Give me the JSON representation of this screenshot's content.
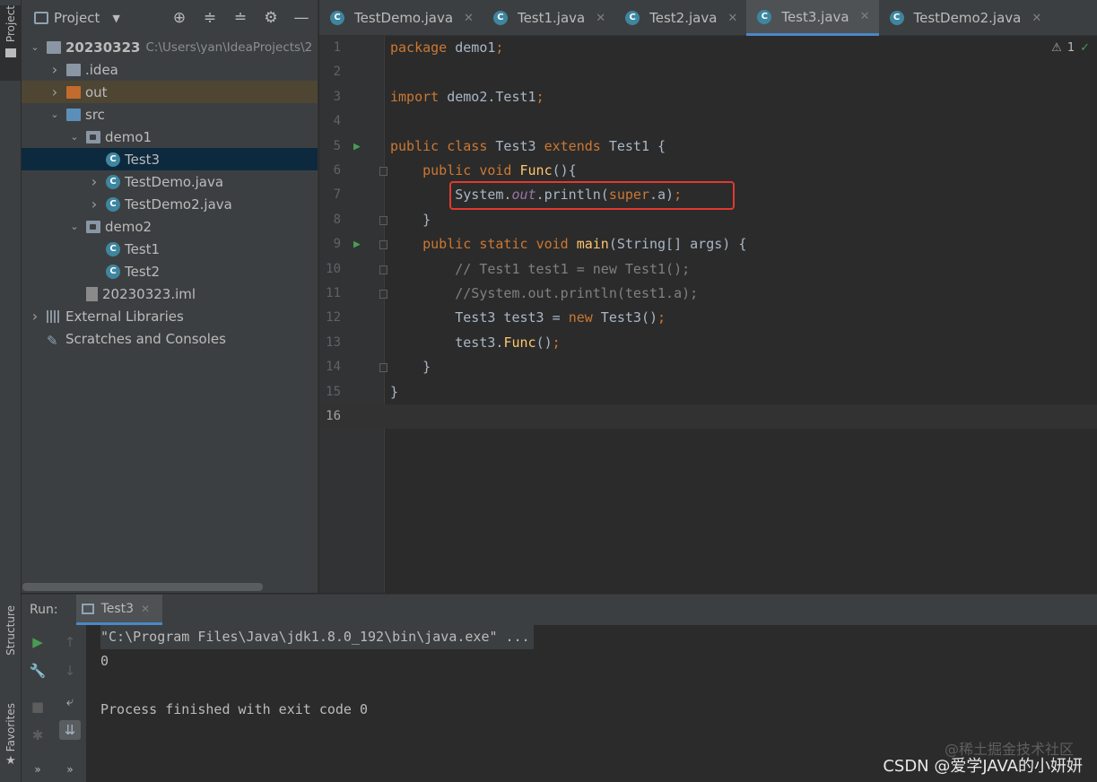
{
  "left_strip": {
    "project_label": "Project",
    "structure_label": "Structure",
    "favorites_label": "Favorites"
  },
  "project_panel": {
    "title": "Project",
    "tree": [
      {
        "label": "20230323",
        "hint": "C:\\Users\\yan\\IdeaProjects\\2",
        "indent": 0,
        "chevron": "down",
        "icon": "module-folder"
      },
      {
        "label": ".idea",
        "indent": 1,
        "chevron": "right",
        "icon": "folder"
      },
      {
        "label": "out",
        "indent": 1,
        "chevron": "right",
        "icon": "folder-orange"
      },
      {
        "label": "src",
        "indent": 1,
        "chevron": "down",
        "icon": "folder-blue"
      },
      {
        "label": "demo1",
        "indent": 2,
        "chevron": "down",
        "icon": "package"
      },
      {
        "label": "Test3",
        "indent": 3,
        "chevron": "",
        "icon": "class"
      },
      {
        "label": "TestDemo.java",
        "indent": 3,
        "chevron": "right",
        "icon": "class"
      },
      {
        "label": "TestDemo2.java",
        "indent": 3,
        "chevron": "right",
        "icon": "class"
      },
      {
        "label": "demo2",
        "indent": 2,
        "chevron": "down",
        "icon": "package"
      },
      {
        "label": "Test1",
        "indent": 3,
        "chevron": "",
        "icon": "class"
      },
      {
        "label": "Test2",
        "indent": 3,
        "chevron": "",
        "icon": "class"
      },
      {
        "label": "20230323.iml",
        "indent": 2,
        "chevron": "",
        "icon": "file"
      },
      {
        "label": "External Libraries",
        "indent": 0,
        "chevron": "right",
        "icon": "library"
      },
      {
        "label": "Scratches and Consoles",
        "indent": 0,
        "chevron": "",
        "icon": "scratch"
      }
    ]
  },
  "tabs": [
    {
      "label": "TestDemo.java",
      "active": false,
      "closable": true
    },
    {
      "label": "Test1.java",
      "active": false,
      "closable": true
    },
    {
      "label": "Test2.java",
      "active": false,
      "closable": true
    },
    {
      "label": "Test3.java",
      "active": true,
      "closable": true
    },
    {
      "label": "TestDemo2.java",
      "active": false,
      "closable": true
    }
  ],
  "editor": {
    "warning_count": "1",
    "lines": [
      {
        "n": "1",
        "code": "package demo1;"
      },
      {
        "n": "2",
        "code": ""
      },
      {
        "n": "3",
        "code": "import demo2.Test1;"
      },
      {
        "n": "4",
        "code": ""
      },
      {
        "n": "5",
        "code": "public class Test3 extends Test1 {"
      },
      {
        "n": "6",
        "code": "    public void Func(){"
      },
      {
        "n": "7",
        "code": "        System.out.println(super.a);"
      },
      {
        "n": "8",
        "code": "    }"
      },
      {
        "n": "9",
        "code": "    public static void main(String[] args) {"
      },
      {
        "n": "10",
        "code": "        // Test1 test1 = new Test1();"
      },
      {
        "n": "11",
        "code": "        //System.out.println(test1.a);"
      },
      {
        "n": "12",
        "code": "        Test3 test3 = new Test3();"
      },
      {
        "n": "13",
        "code": "        test3.Func();"
      },
      {
        "n": "14",
        "code": "    }"
      },
      {
        "n": "15",
        "code": "}"
      },
      {
        "n": "16",
        "code": ""
      }
    ]
  },
  "run_panel": {
    "label": "Run:",
    "tab_label": "Test3",
    "console": [
      "\"C:\\Program Files\\Java\\jdk1.8.0_192\\bin\\java.exe\" ...",
      "0",
      "",
      "Process finished with exit code 0"
    ]
  },
  "watermark": {
    "line1": "@稀土掘金技术社区",
    "line2": "CSDN @爱学JAVA的小妍妍"
  }
}
